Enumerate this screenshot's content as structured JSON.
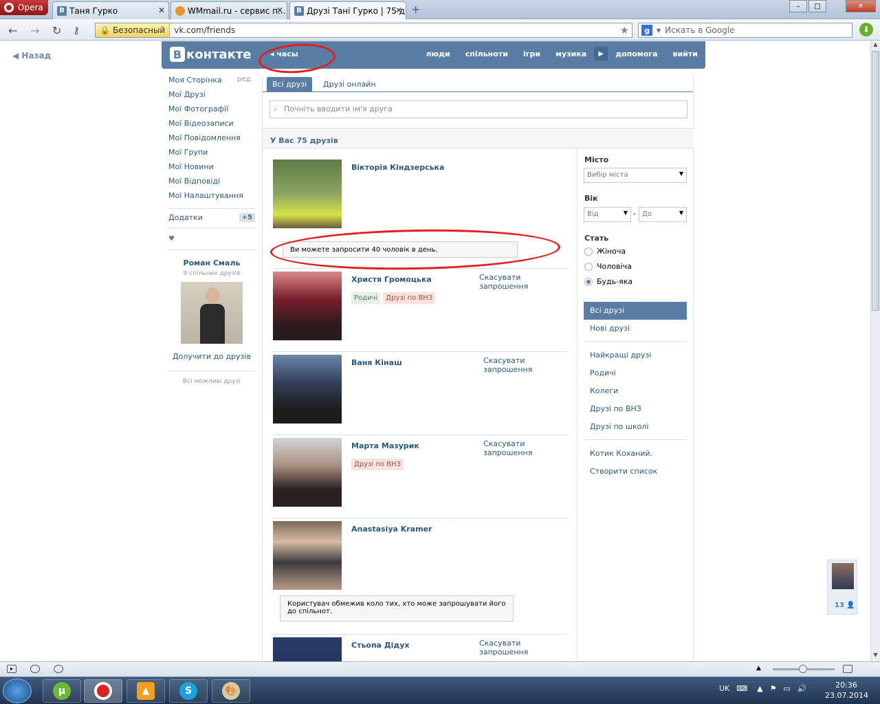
{
  "browser": {
    "menu_label": "Opera",
    "tabs": [
      {
        "label": "Таня Гурко",
        "fav": "B"
      },
      {
        "label": "WMmail.ru - сервис п...",
        "fav": ""
      },
      {
        "label": "Друзі Тані Гурко | 75 д...",
        "fav": "B"
      }
    ],
    "secure_label": "Безопасный",
    "url": "vk.com/friends",
    "search_placeholder": "Искать в Google",
    "window_controls": {
      "minimize": "–",
      "maximize": "□",
      "close": "✕"
    }
  },
  "page": {
    "back_label": "Назад",
    "logo_text": "контакте",
    "logo_letter": "B",
    "header_back": "часы",
    "nav": [
      "люди",
      "спільноти",
      "ігри",
      "музика",
      "допомога",
      "вийти"
    ],
    "left_menu": [
      "Моя Сторінка",
      "Мої Друзі",
      "Мої Фотографії",
      "Мої Відеозаписи",
      "Мої Повідомлення",
      "Мої Групи",
      "Мої Новини",
      "Мої Відповіді",
      "Мої Налаштування"
    ],
    "edit_label": "ред.",
    "addons_label": "Додатки",
    "addons_badge": "+5",
    "heart": "♥",
    "suggest": {
      "name": "Роман Смаль",
      "mutual": "9 спільних друзів",
      "add_label": "Долучити до друзів",
      "all_label": "Всі можливі друзі"
    },
    "tabs": [
      "Всі друзі",
      "Друзі онлайн"
    ],
    "search_placeholder": "Почніть вводити ім'я друга",
    "friends_count": "У Вас 75 друзів",
    "friends": [
      {
        "name": "Вікторія Кіндзерська",
        "cancel": "",
        "tags": [],
        "note": "Ви можете запросити 40 чоловік в день."
      },
      {
        "name": "Христя Громоцька",
        "cancel": "Скасувати запрошення",
        "tags": [
          {
            "text": "Родичі",
            "kind": "g"
          },
          {
            "text": "Друзі по ВНЗ",
            "kind": "r"
          }
        ],
        "note": ""
      },
      {
        "name": "Ваня Кінаш",
        "cancel": "Скасувати запрошення",
        "tags": [],
        "note": ""
      },
      {
        "name": "Марта Мазурик",
        "cancel": "Скасувати запрошення",
        "tags": [
          {
            "text": "Друзі по ВНЗ",
            "kind": "r"
          }
        ],
        "note": ""
      },
      {
        "name": "Anastasiya Kramer",
        "cancel": "",
        "tags": [],
        "note": "Користувач обмежив коло тих, хто може запрошувати його до спільнот."
      },
      {
        "name": "Стьопа Дідух",
        "cancel": "Скасувати запрошення",
        "tags": [],
        "note": ""
      }
    ],
    "filters": {
      "city_label": "Місто",
      "city_value": "Вибір міста",
      "age_label": "Вік",
      "age_from": "Від",
      "age_to": "До",
      "age_dash": "-",
      "sex_label": "Стать",
      "sex_options": [
        "Жіноча",
        "Чоловіча",
        "Будь-яка"
      ],
      "sex_selected": 2,
      "lists": [
        "Всі друзі",
        "Нові друзі",
        "Найкращі друзі",
        "Родичі",
        "Колеги",
        "Друзі по ВНЗ",
        "Друзі по школі",
        "Котик Коханий.",
        "Створити список"
      ]
    },
    "chat_count": "13"
  },
  "taskbar": {
    "lang": "UK",
    "time": "20:36",
    "date": "23.07.2014"
  },
  "colors": {
    "vk_blue": "#597da3",
    "link": "#2b587a",
    "annotation_red": "#e02020"
  }
}
